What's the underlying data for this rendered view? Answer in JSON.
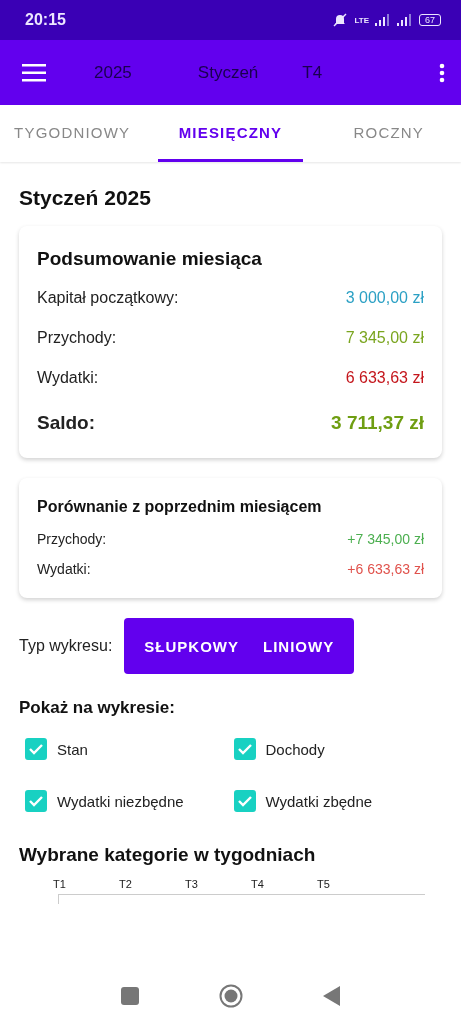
{
  "status_bar": {
    "time": "20:15",
    "network": "LTE",
    "battery": "67"
  },
  "app_bar": {
    "year": "2025",
    "month": "Styczeń",
    "week": "T4"
  },
  "tabs": [
    {
      "label": "TYGODNIOWY",
      "selected": false
    },
    {
      "label": "MIESIĘCZNY",
      "selected": true
    },
    {
      "label": "ROCZNY",
      "selected": false
    }
  ],
  "title": "Styczeń 2025",
  "summary": {
    "title": "Podsumowanie miesiąca",
    "rows": [
      {
        "label": "Kapitał początkowy:",
        "value": "3 000,00 zł",
        "color": "#2ba0c4",
        "kind": "normal"
      },
      {
        "label": "Przychody:",
        "value": "7 345,00 zł",
        "color": "#7aa51f",
        "kind": "normal"
      },
      {
        "label": "Wydatki:",
        "value": "6 633,63 zł",
        "color": "#c4161c",
        "kind": "normal"
      },
      {
        "label": "Saldo:",
        "value": "3 711,37 zł",
        "color": "#6f9e12",
        "kind": "total"
      }
    ]
  },
  "comparison": {
    "title": "Porównanie z poprzednim miesiącem",
    "rows": [
      {
        "label": "Przychody:",
        "value": "+7 345,00 zł",
        "color": "#4caf50"
      },
      {
        "label": "Wydatki:",
        "value": "+6 633,63 zł",
        "color": "#e0524c"
      }
    ]
  },
  "chart_type": {
    "label": "Typ wykresu:",
    "options": [
      "SŁUPKOWY",
      "LINIOWY"
    ]
  },
  "show_on_chart": {
    "title": "Pokaż na wykresie:",
    "options": [
      {
        "label": "Stan",
        "checked": true
      },
      {
        "label": "Dochody",
        "checked": true
      },
      {
        "label": "Wydatki niezbędne",
        "checked": true
      },
      {
        "label": "Wydatki zbędne",
        "checked": true
      }
    ]
  },
  "weekly_section": {
    "title": "Wybrane kategorie w tygodniach",
    "week_labels": [
      "T1",
      "T2",
      "T3",
      "T4",
      "T5"
    ]
  }
}
